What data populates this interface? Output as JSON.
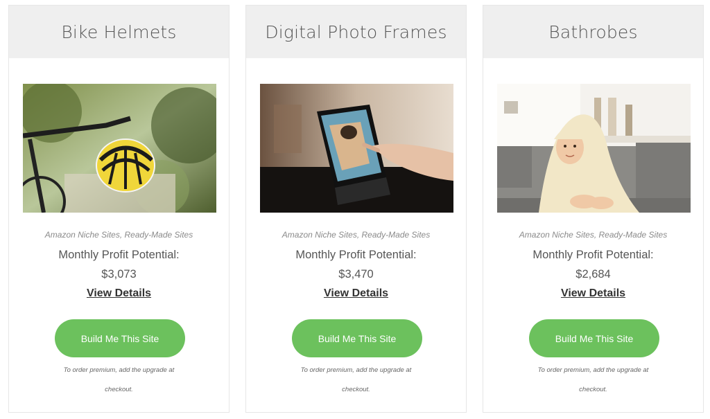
{
  "cards": [
    {
      "title": "Bike Helmets",
      "image_icon": "bike-helmet-photo",
      "categories": "Amazon Niche Sites, Ready-Made Sites",
      "profit_label": "Monthly Profit Potential:",
      "profit_value": "$3,073",
      "details_label": "View Details",
      "button_label": "Build Me This Site",
      "note": "To order premium, add the upgrade at checkout."
    },
    {
      "title": "Digital Photo Frames",
      "image_icon": "digital-photo-frame-photo",
      "categories": "Amazon Niche Sites, Ready-Made Sites",
      "profit_label": "Monthly Profit Potential:",
      "profit_value": "$3,470",
      "details_label": "View Details",
      "button_label": "Build Me This Site",
      "note": "To order premium, add the upgrade at checkout."
    },
    {
      "title": "Bathrobes",
      "image_icon": "bathrobe-child-photo",
      "categories": "Amazon Niche Sites, Ready-Made Sites",
      "profit_label": "Monthly Profit Potential:",
      "profit_value": "$2,684",
      "details_label": "View Details",
      "button_label": "Build Me This Site",
      "note": "To order premium, add the upgrade at checkout."
    }
  ],
  "colors": {
    "header_bg": "#efefef",
    "button_green": "#6cc15d",
    "card_border": "#e6e6e6"
  }
}
